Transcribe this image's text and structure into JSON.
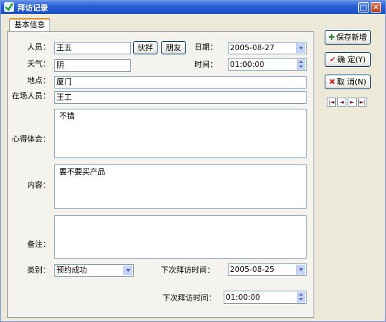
{
  "window": {
    "title": "拜访记录",
    "minimize_label": "□",
    "close_label": "✕"
  },
  "tab": {
    "label": "基本信息"
  },
  "form": {
    "person_label": "人员：",
    "person_value": "王五",
    "partner_button": "伙拌",
    "friend_button": "朋友",
    "date_label": "日期：",
    "date_value": "2005-08-27",
    "weather_label": "天气：",
    "weather_value": "阴",
    "time_label": "时间：",
    "time_value": "01:00:00",
    "location_label": "地点：",
    "location_value": "厦门",
    "present_label": "在场人员：",
    "present_value": "王工",
    "insight_label": "心得体会：",
    "insight_value": "不错",
    "content_label": "内容：",
    "content_value": "要不要买产品",
    "remark_label": "备注：",
    "remark_value": "",
    "category_label": "类别：",
    "category_value": "预约成功",
    "next_date_label": "下次拜访时间：",
    "next_date_value": "2005-08-25",
    "next_time_label": "下次拜访时间：",
    "next_time_value": "01:00:00"
  },
  "side": {
    "save_new": "保存新增",
    "confirm": "确 定",
    "confirm_key": "(Y)",
    "cancel": "取 消",
    "cancel_key": "(N)"
  },
  "nav": {
    "first": "|◄",
    "prev": "◄",
    "next": "►",
    "last": "►|"
  }
}
